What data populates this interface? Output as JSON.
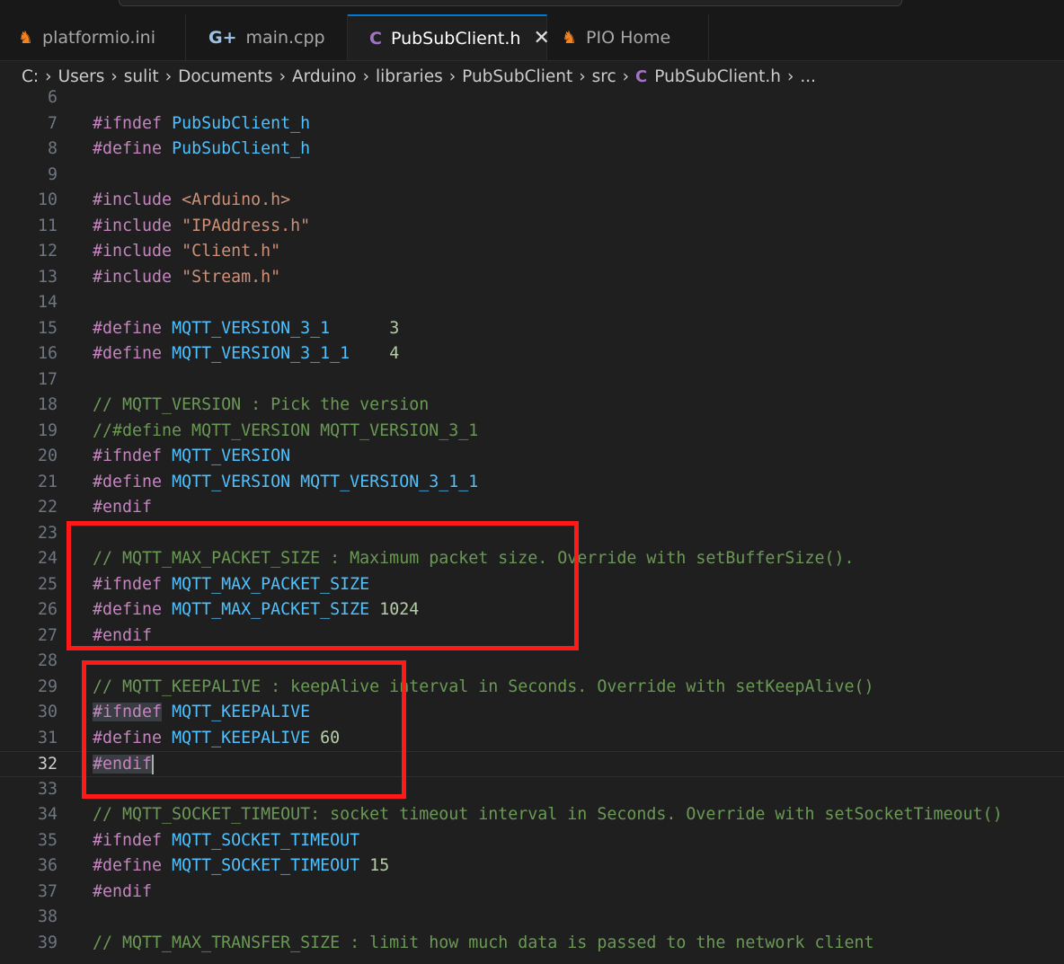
{
  "tabs": [
    {
      "label": "platformio.ini",
      "icon": "platformio-icon",
      "icon_glyph": "♞",
      "icon_color": "#f5821f",
      "active": false
    },
    {
      "label": "main.cpp",
      "icon": "cpp-file-icon",
      "icon_glyph": "G+",
      "icon_color": "#9cc3e6",
      "active": false
    },
    {
      "label": "PubSubClient.h",
      "icon": "c-header-file-icon",
      "icon_glyph": "C",
      "icon_color": "#a074c4",
      "active": true,
      "close": "✕"
    },
    {
      "label": "PIO Home",
      "icon": "platformio-icon",
      "icon_glyph": "♞",
      "icon_color": "#f5821f",
      "active": false
    }
  ],
  "breadcrumb": [
    "C:",
    "Users",
    "sulit",
    "Documents",
    "Arduino",
    "libraries",
    "PubSubClient",
    "src",
    "PubSubClient.h",
    "..."
  ],
  "breadcrumb_file_icon": "C",
  "current_line": 32,
  "lines": [
    {
      "n": "6",
      "t": []
    },
    {
      "n": "7",
      "t": [
        [
          "kw",
          "#ifndef"
        ],
        [
          "p",
          " "
        ],
        [
          "id",
          "PubSubClient_h"
        ]
      ]
    },
    {
      "n": "8",
      "t": [
        [
          "kw",
          "#define"
        ],
        [
          "p",
          " "
        ],
        [
          "id",
          "PubSubClient_h"
        ]
      ]
    },
    {
      "n": "9",
      "t": []
    },
    {
      "n": "10",
      "t": [
        [
          "kw",
          "#include"
        ],
        [
          "p",
          " "
        ],
        [
          "str",
          "<Arduino.h>"
        ]
      ]
    },
    {
      "n": "11",
      "t": [
        [
          "kw",
          "#include"
        ],
        [
          "p",
          " "
        ],
        [
          "str",
          "\"IPAddress.h\""
        ]
      ]
    },
    {
      "n": "12",
      "t": [
        [
          "kw",
          "#include"
        ],
        [
          "p",
          " "
        ],
        [
          "str",
          "\"Client.h\""
        ]
      ]
    },
    {
      "n": "13",
      "t": [
        [
          "kw",
          "#include"
        ],
        [
          "p",
          " "
        ],
        [
          "str",
          "\"Stream.h\""
        ]
      ]
    },
    {
      "n": "14",
      "t": []
    },
    {
      "n": "15",
      "t": [
        [
          "kw",
          "#define"
        ],
        [
          "p",
          " "
        ],
        [
          "id",
          "MQTT_VERSION_3_1"
        ],
        [
          "p",
          "      "
        ],
        [
          "num",
          "3"
        ]
      ]
    },
    {
      "n": "16",
      "t": [
        [
          "kw",
          "#define"
        ],
        [
          "p",
          " "
        ],
        [
          "id",
          "MQTT_VERSION_3_1_1"
        ],
        [
          "p",
          "    "
        ],
        [
          "num",
          "4"
        ]
      ]
    },
    {
      "n": "17",
      "t": []
    },
    {
      "n": "18",
      "t": [
        [
          "cm",
          "// MQTT_VERSION : Pick the version"
        ]
      ]
    },
    {
      "n": "19",
      "t": [
        [
          "cm",
          "//#define MQTT_VERSION MQTT_VERSION_3_1"
        ]
      ]
    },
    {
      "n": "20",
      "t": [
        [
          "kw",
          "#ifndef"
        ],
        [
          "p",
          " "
        ],
        [
          "id",
          "MQTT_VERSION"
        ]
      ]
    },
    {
      "n": "21",
      "t": [
        [
          "kw",
          "#define"
        ],
        [
          "p",
          " "
        ],
        [
          "id",
          "MQTT_VERSION"
        ],
        [
          "p",
          " "
        ],
        [
          "id",
          "MQTT_VERSION_3_1_1"
        ]
      ]
    },
    {
      "n": "22",
      "t": [
        [
          "kw",
          "#endif"
        ]
      ]
    },
    {
      "n": "23",
      "t": []
    },
    {
      "n": "24",
      "t": [
        [
          "cm",
          "// MQTT_MAX_PACKET_SIZE : Maximum packet size. Override with setBufferSize()."
        ]
      ]
    },
    {
      "n": "25",
      "t": [
        [
          "kw",
          "#ifndef"
        ],
        [
          "p",
          " "
        ],
        [
          "id",
          "MQTT_MAX_PACKET_SIZE"
        ]
      ]
    },
    {
      "n": "26",
      "t": [
        [
          "kw",
          "#define"
        ],
        [
          "p",
          " "
        ],
        [
          "id",
          "MQTT_MAX_PACKET_SIZE"
        ],
        [
          "p",
          " "
        ],
        [
          "num",
          "1024"
        ]
      ]
    },
    {
      "n": "27",
      "t": [
        [
          "kw",
          "#endif"
        ]
      ]
    },
    {
      "n": "28",
      "t": []
    },
    {
      "n": "29",
      "t": [
        [
          "cm",
          "// MQTT_KEEPALIVE : keepAlive interval in Seconds. Override with setKeepAlive()"
        ]
      ]
    },
    {
      "n": "30",
      "t": [
        [
          "kwh",
          "#ifndef"
        ],
        [
          "p",
          " "
        ],
        [
          "id",
          "MQTT_KEEPALIVE"
        ]
      ]
    },
    {
      "n": "31",
      "t": [
        [
          "kw",
          "#define"
        ],
        [
          "p",
          " "
        ],
        [
          "id",
          "MQTT_KEEPALIVE"
        ],
        [
          "p",
          " "
        ],
        [
          "num",
          "60"
        ]
      ]
    },
    {
      "n": "32",
      "t": [
        [
          "kwh",
          "#endif"
        ],
        [
          "caret",
          ""
        ]
      ]
    },
    {
      "n": "33",
      "t": []
    },
    {
      "n": "34",
      "t": [
        [
          "cm",
          "// MQTT_SOCKET_TIMEOUT: socket timeout interval in Seconds. Override with setSocketTimeout()"
        ]
      ]
    },
    {
      "n": "35",
      "t": [
        [
          "kw",
          "#ifndef"
        ],
        [
          "p",
          " "
        ],
        [
          "id",
          "MQTT_SOCKET_TIMEOUT"
        ]
      ]
    },
    {
      "n": "36",
      "t": [
        [
          "kw",
          "#define"
        ],
        [
          "p",
          " "
        ],
        [
          "id",
          "MQTT_SOCKET_TIMEOUT"
        ],
        [
          "p",
          " "
        ],
        [
          "num",
          "15"
        ]
      ]
    },
    {
      "n": "37",
      "t": [
        [
          "kw",
          "#endif"
        ]
      ]
    },
    {
      "n": "38",
      "t": []
    },
    {
      "n": "39",
      "t": [
        [
          "cm",
          "// MQTT_MAX_TRANSFER_SIZE : limit how much data is passed to the network client"
        ]
      ]
    }
  ],
  "annotation_color": "#ff1a1a"
}
